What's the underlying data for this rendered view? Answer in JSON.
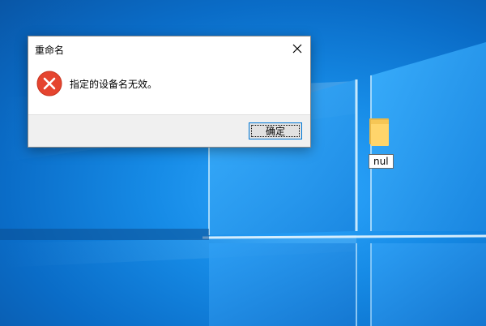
{
  "dialog": {
    "title": "重命名",
    "message": "指定的设备名无效。",
    "ok_label": "确定"
  },
  "desktop": {
    "folder_name": "nul"
  },
  "colors": {
    "wallpaper_blue": "#168be6",
    "error_red": "#e5442f",
    "button_focus": "#0078d7"
  },
  "icons": {
    "dialog_close": "close-icon",
    "dialog_error": "error-icon",
    "desktop_folder": "folder-icon"
  }
}
